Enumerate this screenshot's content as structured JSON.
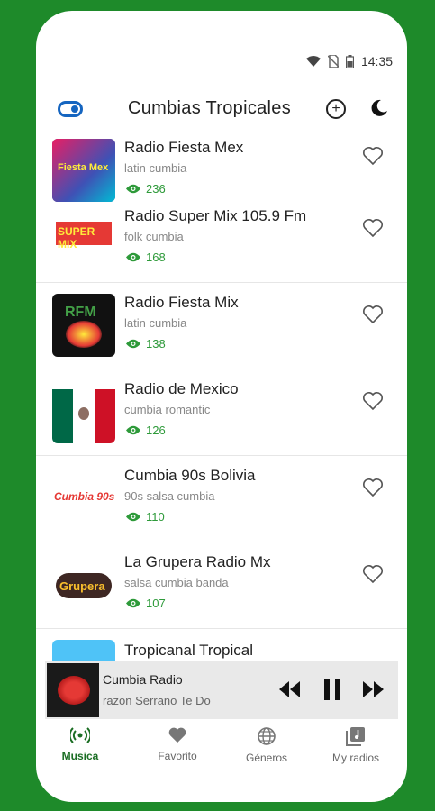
{
  "status": {
    "time": "14:35"
  },
  "appbar": {
    "title": "Cumbias Tropicales"
  },
  "stations": [
    {
      "name": "Radio Fiesta Mex",
      "genre": "latin cumbia",
      "views": "236",
      "thumb_text": "Fiesta Mex",
      "thumb_bg": "#1a237e"
    },
    {
      "name": "Radio Super Mix 105.9 Fm",
      "genre": "folk cumbia",
      "views": "168",
      "thumb_text": "SUPER MIX",
      "thumb_bg": "#ffffff"
    },
    {
      "name": "Radio Fiesta Mix",
      "genre": "latin cumbia",
      "views": "138",
      "thumb_text": "RFM",
      "thumb_bg": "#111111"
    },
    {
      "name": "Radio de Mexico",
      "genre": "cumbia romantic",
      "views": "126",
      "thumb_text": "",
      "thumb_bg": "#ffffff"
    },
    {
      "name": "Cumbia 90s Bolivia",
      "genre": "90s salsa cumbia",
      "views": "110",
      "thumb_text": "Cumbia 90s",
      "thumb_bg": "#ffffff"
    },
    {
      "name": "La Grupera Radio Mx",
      "genre": "salsa cumbia banda",
      "views": "107",
      "thumb_text": "Grupera",
      "thumb_bg": "#ffffff"
    },
    {
      "name": "Tropicanal Tropical",
      "genre": "",
      "views": "",
      "thumb_text": "",
      "thumb_bg": "#4fc3f7"
    }
  ],
  "player": {
    "title": "Cumbia Radio",
    "subtitle": "razon Serrano          Te Do"
  },
  "nav": [
    {
      "label": "Musica"
    },
    {
      "label": "Favorito"
    },
    {
      "label": "Géneros"
    },
    {
      "label": "My radios"
    }
  ],
  "colors": {
    "accent": "#2e9a3a",
    "background": "#1e8a2a",
    "toggle": "#1565c0"
  }
}
